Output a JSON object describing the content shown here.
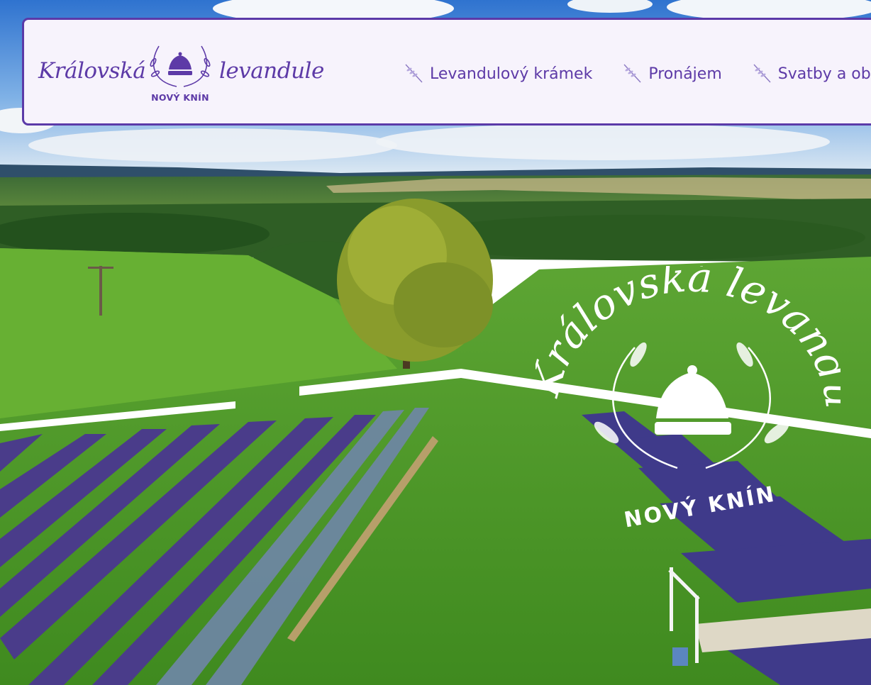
{
  "brand": {
    "word_left": "Královská",
    "word_right": "levandule",
    "subtitle": "NOVÝ KNÍN",
    "color": "#5d3aa7",
    "emblem_icon": "crown-lavender-wreath-icon"
  },
  "nav": {
    "items": [
      {
        "label": "Levandulový krámek",
        "icon": "lavender-sprig-icon"
      },
      {
        "label": "Pronájem",
        "icon": "lavender-sprig-icon"
      },
      {
        "label": "Svatby a ob",
        "icon": "lavender-sprig-icon"
      }
    ]
  },
  "hero": {
    "image": "aerial-lavender-field-photo",
    "overlay_logo": {
      "arc_text": "Královská levandule",
      "bottom_text": "NOVÝ KNÍN",
      "color": "#ffffff",
      "icon": "crown-icon"
    }
  },
  "colors": {
    "accent": "#5b3aa8",
    "header_bg": "#f7f3fc"
  }
}
